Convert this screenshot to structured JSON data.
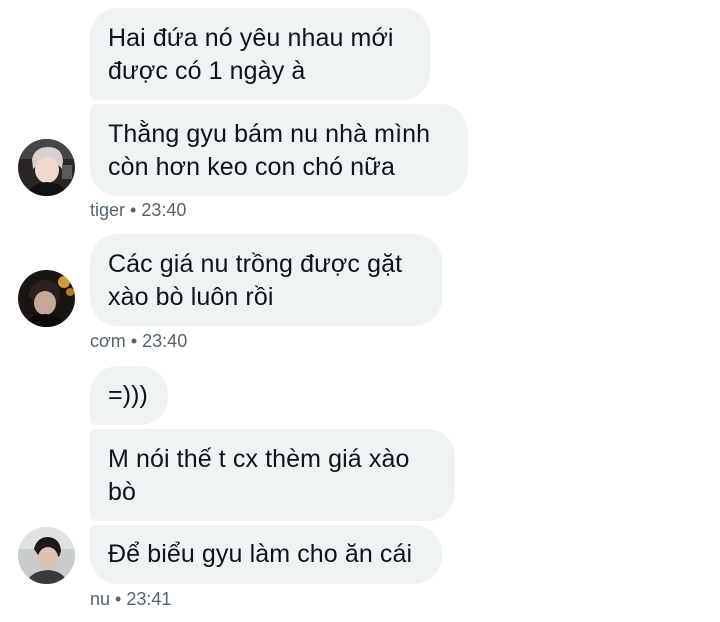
{
  "messages": [
    {
      "sender": "tiger",
      "time": "23:40",
      "bubbles": [
        "Hai đứa nó yêu nhau mới được có 1 ngày à",
        "Thằng gyu bám nu nhà mình còn hơn keo con chó nữa"
      ]
    },
    {
      "sender": "cơm",
      "time": "23:40",
      "bubbles": [
        "Các giá nu trồng được gặt xào bò luôn rồi"
      ]
    },
    {
      "sender": "nu",
      "time": "23:41",
      "bubbles": [
        "=)))",
        "M nói thế t cx thèm giá xào bò",
        "Để biểu gyu làm cho ăn cái"
      ]
    }
  ],
  "meta_separator": "•",
  "avatars": [
    "person-avatar",
    "person-avatar",
    "person-avatar"
  ],
  "colors": {
    "bubble_bg": "#eff3f4",
    "text": "#0f1419",
    "meta": "#536471",
    "background": "#ffffff"
  }
}
